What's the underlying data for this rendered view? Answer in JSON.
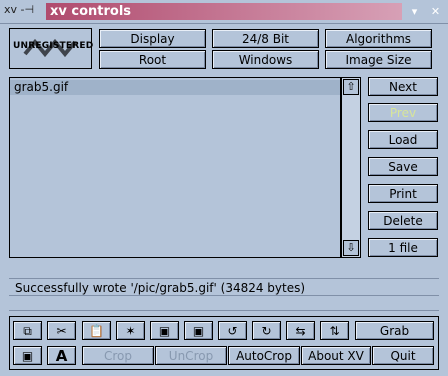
{
  "window": {
    "title": "xv controls",
    "titlebar_left_glyph": "xv -⊣"
  },
  "top_buttons": {
    "row1": [
      "Display",
      "24/8 Bit",
      "Algorithms"
    ],
    "row2": [
      "Root",
      "Windows",
      "Image Size"
    ]
  },
  "badge": {
    "label": "UNREGISTERED"
  },
  "file_list": {
    "items": [
      "grab5.gif"
    ]
  },
  "right_buttons": [
    "Next",
    "Prev",
    "Load",
    "Save",
    "Print",
    "Delete",
    "1 file"
  ],
  "status": {
    "message": "Successfully wrote '/pic/grab5.gif'  (34824 bytes)"
  },
  "bottom_buttons": {
    "row1_right": "Grab",
    "row2": [
      "Crop",
      "UnCrop",
      "AutoCrop",
      "About XV",
      "Quit"
    ]
  },
  "icons": {
    "titlebar": [
      "window-menu-icon",
      "minimize-icon",
      "close-icon"
    ],
    "bottom": [
      "copy-icon",
      "cut-icon",
      "paste-icon",
      "sparkle-icon",
      "rotate-left-icon",
      "rotate-right-icon",
      "flip-horizontal-icon",
      "flip-vertical-icon",
      "square-icon",
      "text-icon"
    ]
  },
  "colors": {
    "title_bg_start": "#b04b6e",
    "title_bg_end": "#d7a0b6",
    "panel_bg": "#b4c4d9"
  }
}
